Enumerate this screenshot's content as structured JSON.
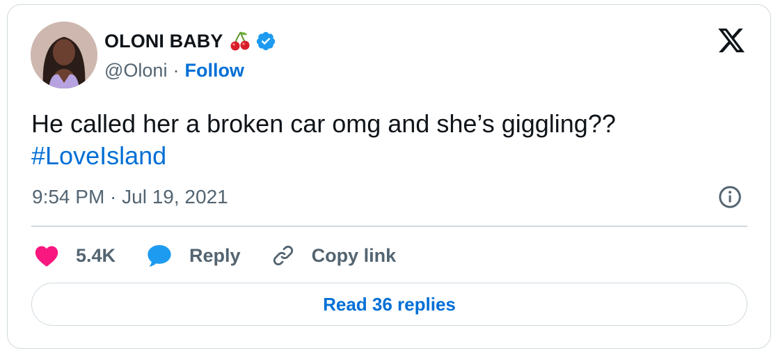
{
  "author": {
    "display_name": "OLONI BABY",
    "name_emoji": "cherries-emoji",
    "verified_icon": "verified-badge-icon",
    "handle": "@Oloni",
    "separator": "·",
    "follow_label": "Follow",
    "avatar_icon": "profile-avatar"
  },
  "platform_logo": "x-logo-icon",
  "tweet": {
    "text": "He called her a broken car omg and she’s giggling??",
    "hashtag": "#LoveIsland",
    "timestamp": "9:54 PM · Jul 19, 2021"
  },
  "actions": {
    "like_count": "5.4K",
    "reply_label": "Reply",
    "copy_link_label": "Copy link"
  },
  "read_replies_label": "Read 36 replies",
  "colors": {
    "link_blue": "#006fd6",
    "heart_pink": "#f91880",
    "reply_bubble_blue": "#1d9bf0",
    "verified_blue": "#1d9bf0",
    "muted_text": "#536471",
    "border": "#cfd9de"
  }
}
